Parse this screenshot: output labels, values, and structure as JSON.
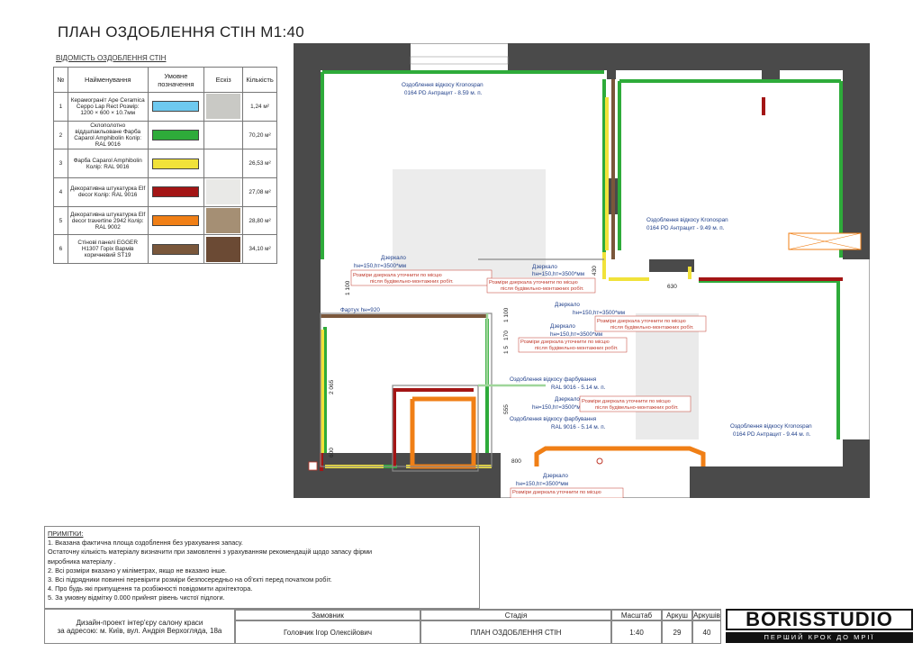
{
  "title": "ПЛАН ОЗДОБЛЕННЯ СТІН М1:40",
  "legend": {
    "title": "ВІДОМІСТЬ ОЗДОБЛЕННЯ СТІН",
    "headers": [
      "№",
      "Найменування",
      "Умовне позначення",
      "Ескіз",
      "Кількість"
    ],
    "rows": [
      {
        "n": "1",
        "name": "Керамограніт Ape Ceramica Ceppo Lap Rect Розмір: 1200 × 600 × 10.7мм",
        "color": "#6ec9ef",
        "sketch": "#c9c9c5",
        "qty": "1,24 м²"
      },
      {
        "n": "2",
        "name": "Склополотно віддшпакльоване Фарба Caparol Amphibolin Колір: RAL 9016",
        "color": "#2eab3a",
        "sketch": "#ffffff",
        "qty": "70,20 м²"
      },
      {
        "n": "3",
        "name": "Фарба Caparol Amphibolin Колір: RAL 9016",
        "color": "#f1e23a",
        "sketch": "#ffffff",
        "qty": "26,53 м²"
      },
      {
        "n": "4",
        "name": "Декоративна штукатурка Elf decor Колір: RAL 9016",
        "color": "#a31515",
        "sketch": "#e9e9e7",
        "qty": "27,08 м²"
      },
      {
        "n": "5",
        "name": "Декоративна штукатурка Elf decor travertine 2942 Колір: RAL 9002",
        "color": "#f07f16",
        "sketch": "#a58f74",
        "qty": "28,80 м²"
      },
      {
        "n": "6",
        "name": "Стінові панелі EGGER H1307 Горіх Вармів коричневий ST19",
        "color": "#7a573b",
        "sketch": "#6b4a34",
        "qty": "34,10 м²"
      }
    ]
  },
  "plan": {
    "labels": {
      "kronospan1a": "Оздоблення відкосу Kronospan",
      "kronospan1b": "0164 PD Антрацит - 8.59 м. п.",
      "kronospan2a": "Оздоблення відкосу Kronospan",
      "kronospan2b": "0164 PD Антрацит - 9.49 м. п.",
      "kronospan3a": "Оздоблення відкосу Kronospan",
      "kronospan3b": "0164 PD Антрацит - 9.44 м. п.",
      "paint1a": "Оздоблення відкосу фарбування",
      "paint1b": "RAL 9016 - 5.14 м. п.",
      "paint2a": "Оздоблення відкосу фарбування",
      "paint2b": "RAL 9016 - 5.14 м. п.",
      "mirror": "Дзеркало",
      "mirror_size": "hн=150,hт=3500*мм",
      "mirror_note1": "Розміри дзеркала уточнити по місцю",
      "mirror_note2": "після будівельно-монтажних робіт.",
      "apron": "Фартух hн=920"
    },
    "dims": [
      "1 100",
      "2 065",
      "600",
      "555",
      "430",
      "630",
      "800",
      "1 100",
      "170",
      "1 5"
    ]
  },
  "notes": {
    "title": "ПРИМІТКИ:",
    "lines": [
      "1.  Вказана фактична площа оздоблення без урахування запасу.",
      "Остаточну кількість матеріалу визначити при замовленні з урахуванням рекомендацій щодо запасу фірми",
      "виробника матеріалу .",
      "2. Всі розміри вказано у міліметрах, якщо не вказано інше.",
      "3. Всі підрядники повинні перевірити розміри безпосередньо на об'єкті перед початком робіт.",
      "4. Про будь які припущення та розбіжності повідомити архітектора.",
      "5. За умовну відмітку 0.000 прийнят рівень чистої підлоги."
    ]
  },
  "stamp": {
    "project1": "Дизайн-проект інтер'єру салону краси",
    "project2": "за адресою: м. Київ, вул. Андрія Верхогляда, 18а",
    "client_h": "Замовник",
    "client": "Головчик Ігор Олексійович",
    "stage_h": "Стадія",
    "stage": "ПЛАН ОЗДОБЛЕННЯ СТІН",
    "scale_h": "Масштаб",
    "scale": "1:40",
    "sheet_h": "Аркуш",
    "sheet": "29",
    "sheets_h": "Аркушів",
    "sheets": "40"
  },
  "logo": {
    "name": "BORISSTUDIO",
    "slogan": "ПЕРШИЙ КРОК ДО МРІЇ"
  }
}
